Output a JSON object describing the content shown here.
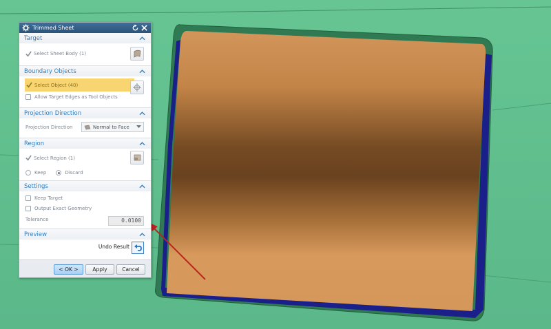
{
  "dialog": {
    "title": "Trimmed Sheet",
    "icons": [
      "gear-icon",
      "reset-icon",
      "close-icon"
    ]
  },
  "target": {
    "header": "Target",
    "select_sheet_body": "Select Sheet Body (1)"
  },
  "boundary": {
    "header": "Boundary Objects",
    "select_object": "Select Object (40)",
    "allow_target_edges": "Allow Target Edges as Tool Objects"
  },
  "projection": {
    "header": "Projection Direction",
    "label": "Projection Direction",
    "value": "Normal to Face"
  },
  "region": {
    "header": "Region",
    "select_region": "Select Region (1)",
    "keep": "Keep",
    "discard": "Discard",
    "selected_option": "Discard"
  },
  "settings": {
    "header": "Settings",
    "keep_target": "Keep Target",
    "output_exact_geometry": "Output Exact Geometry",
    "tolerance_label": "Tolerance",
    "tolerance_value": "0.0100"
  },
  "preview": {
    "header": "Preview",
    "undo_result": "Undo Result"
  },
  "buttons": {
    "ok": "< OK >",
    "apply": "Apply",
    "cancel": "Cancel"
  },
  "colors": {
    "background_surface": "#5fbf8d",
    "sheet_surface": "#c98a4a",
    "sheet_edge": "#1a1f8a",
    "highlight": "#f8d570",
    "section_title": "#2f7cbf",
    "annotation_arrow": "#c42020"
  }
}
